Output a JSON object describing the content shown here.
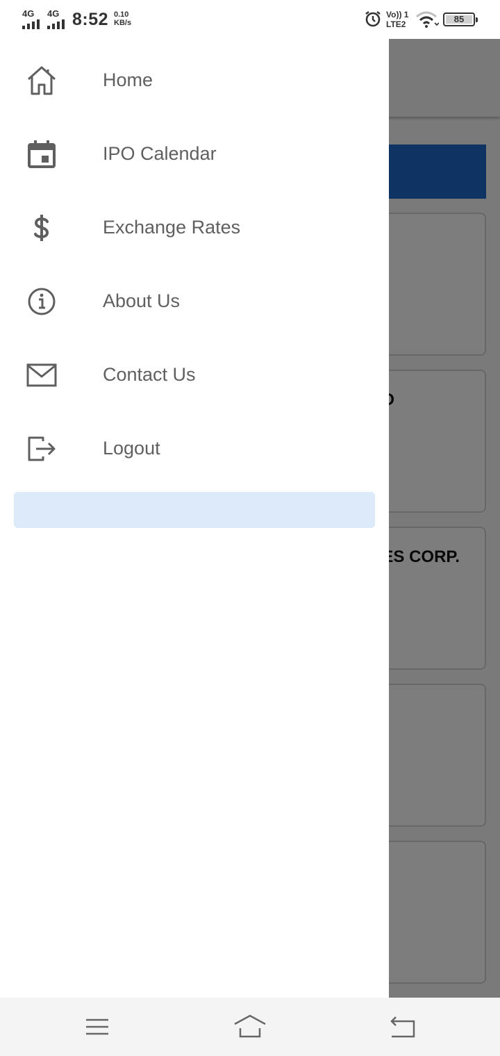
{
  "status_bar": {
    "sim1_type": "4G",
    "sim2_type": "4G",
    "time": "8:52",
    "speed_value": "0.10",
    "speed_unit": "KB/s",
    "volte_line1": "Vo)) 1",
    "volte_line2": "LTE2",
    "battery": "85"
  },
  "background_app": {
    "cards": [
      {
        "name": ""
      },
      {
        "name": "O"
      },
      {
        "name": "ES CORP."
      },
      {
        "name": ""
      },
      {
        "name": ""
      }
    ],
    "colors": {
      "banner": "#1a68c4"
    }
  },
  "drawer": {
    "items": [
      {
        "label": "Home",
        "icon": "home-icon"
      },
      {
        "label": "IPO Calendar",
        "icon": "calendar-icon"
      },
      {
        "label": "Exchange Rates",
        "icon": "dollar-icon"
      },
      {
        "label": "About Us",
        "icon": "info-icon"
      },
      {
        "label": "Contact Us",
        "icon": "mail-icon"
      },
      {
        "label": "Logout",
        "icon": "logout-icon"
      }
    ],
    "colors": {
      "highlight": "#ddeafa",
      "text": "#5f5f5f"
    }
  },
  "nav_bar": {
    "buttons": [
      "menu-icon",
      "home-icon",
      "back-icon"
    ]
  }
}
